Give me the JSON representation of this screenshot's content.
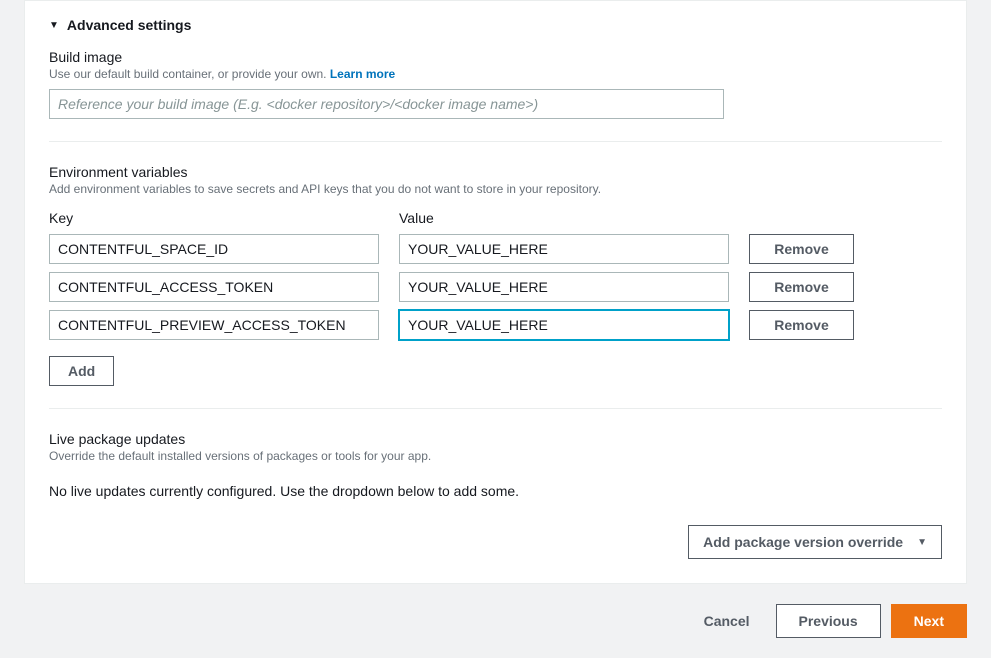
{
  "advanced": {
    "title": "Advanced settings"
  },
  "buildImage": {
    "label": "Build image",
    "help": "Use our default build container, or provide your own.",
    "learnMore": "Learn more",
    "placeholder": "Reference your build image (E.g. <docker repository>/<docker image name>)"
  },
  "envVars": {
    "heading": "Environment variables",
    "help": "Add environment variables to save secrets and API keys that you do not want to store in your repository.",
    "keyLabel": "Key",
    "valueLabel": "Value",
    "rows": [
      {
        "key": "CONTENTFUL_SPACE_ID",
        "value": "YOUR_VALUE_HERE"
      },
      {
        "key": "CONTENTFUL_ACCESS_TOKEN",
        "value": "YOUR_VALUE_HERE"
      },
      {
        "key": "CONTENTFUL_PREVIEW_ACCESS_TOKEN",
        "value": "YOUR_VALUE_HERE"
      }
    ],
    "removeLabel": "Remove",
    "addLabel": "Add"
  },
  "live": {
    "heading": "Live package updates",
    "help": "Override the default installed versions of packages or tools for your app.",
    "empty": "No live updates currently configured. Use the dropdown below to add some.",
    "addOverrideLabel": "Add package version override"
  },
  "footer": {
    "cancel": "Cancel",
    "previous": "Previous",
    "next": "Next"
  }
}
